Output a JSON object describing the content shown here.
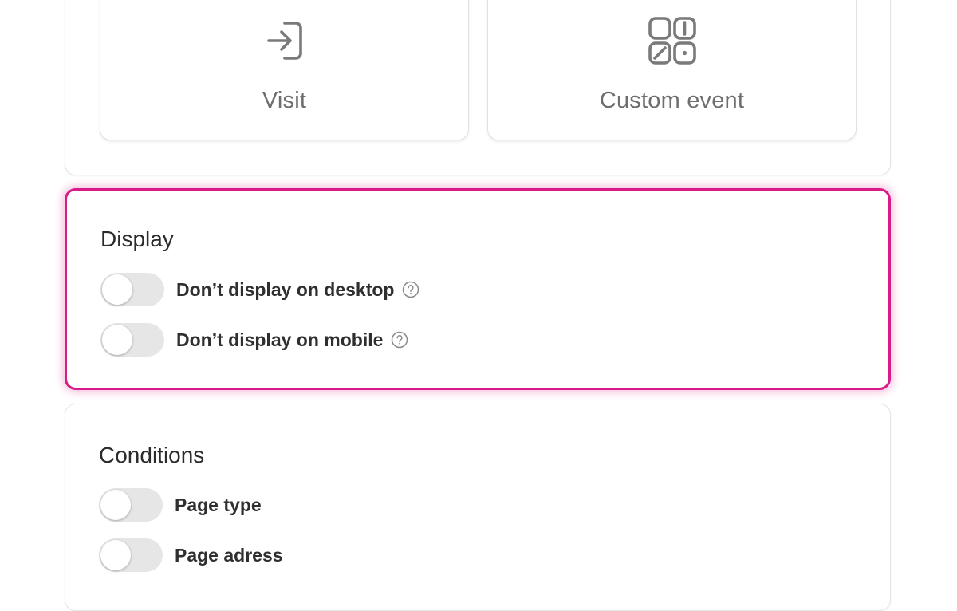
{
  "triggers": {
    "items": [
      {
        "label": "Visit",
        "icon": "enter-icon"
      },
      {
        "label": "Custom event",
        "icon": "apps-grid-icon"
      }
    ]
  },
  "display": {
    "title": "Display",
    "options": [
      {
        "label": "Don’t display on desktop",
        "enabled": false,
        "has_help": true
      },
      {
        "label": "Don’t display on mobile",
        "enabled": false,
        "has_help": true
      }
    ]
  },
  "conditions": {
    "title": "Conditions",
    "options": [
      {
        "label": "Page type",
        "enabled": false
      },
      {
        "label": "Page adress",
        "enabled": false
      }
    ]
  },
  "colors": {
    "accent": "#d81b86",
    "toggle_off": "#e6e6e6",
    "icon_gray": "#7a7a7a"
  }
}
